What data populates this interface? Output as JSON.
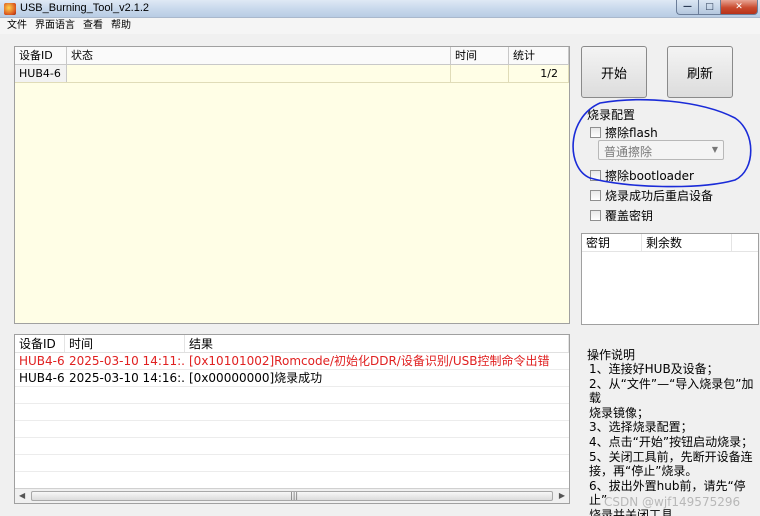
{
  "window": {
    "title": "USB_Burning_Tool_v2.1.2"
  },
  "menu": [
    "文件",
    "界面语言",
    "查看",
    "帮助"
  ],
  "device_grid": {
    "headers": {
      "id": "设备ID",
      "status": "状态",
      "time": "时间",
      "stat": "统计"
    },
    "rows": [
      {
        "id": "HUB4-6",
        "status": "",
        "time": "",
        "stat": "1/2"
      }
    ]
  },
  "log": {
    "headers": {
      "id": "设备ID",
      "time": "时间",
      "result": "结果"
    },
    "rows": [
      {
        "id": "HUB4-6",
        "time": "2025-03-10 14:11:...",
        "result": "[0x10101002]Romcode/初始化DDR/设备识别/USB控制命令出错",
        "level": "error"
      },
      {
        "id": "HUB4-6",
        "time": "2025-03-10 14:16:...",
        "result": "[0x00000000]烧录成功",
        "level": "normal"
      }
    ]
  },
  "buttons": {
    "start": "开始",
    "refresh": "刷新"
  },
  "burn_config": {
    "title": "烧录配置",
    "erase_flash": "擦除flash",
    "erase_mode": "普通擦除",
    "erase_bootloader": "擦除bootloader",
    "reboot_after": "烧录成功后重启设备",
    "overwrite_key": "覆盖密钥"
  },
  "key_table": {
    "headers": {
      "key": "密钥",
      "remaining": "剩余数"
    }
  },
  "instructions": {
    "title": "操作说明",
    "lines": [
      "1、连接好HUB及设备；",
      "2、从“文件”—“导入烧录包”加载",
      "烧录镜像；",
      "3、选择烧录配置；",
      "4、点击“开始”按钮启动烧录；",
      "5、关闭工具前，先断开设备连",
      "接，再“停止”烧录。",
      "6、拔出外置hub前，请先“停止”",
      "烧录并关闭工具。"
    ]
  },
  "watermark": "CSDN @wjf149575296",
  "colors": {
    "grid_bg": "#fffee6",
    "error_text": "#e02020",
    "annotation": "#1a2bd8"
  }
}
